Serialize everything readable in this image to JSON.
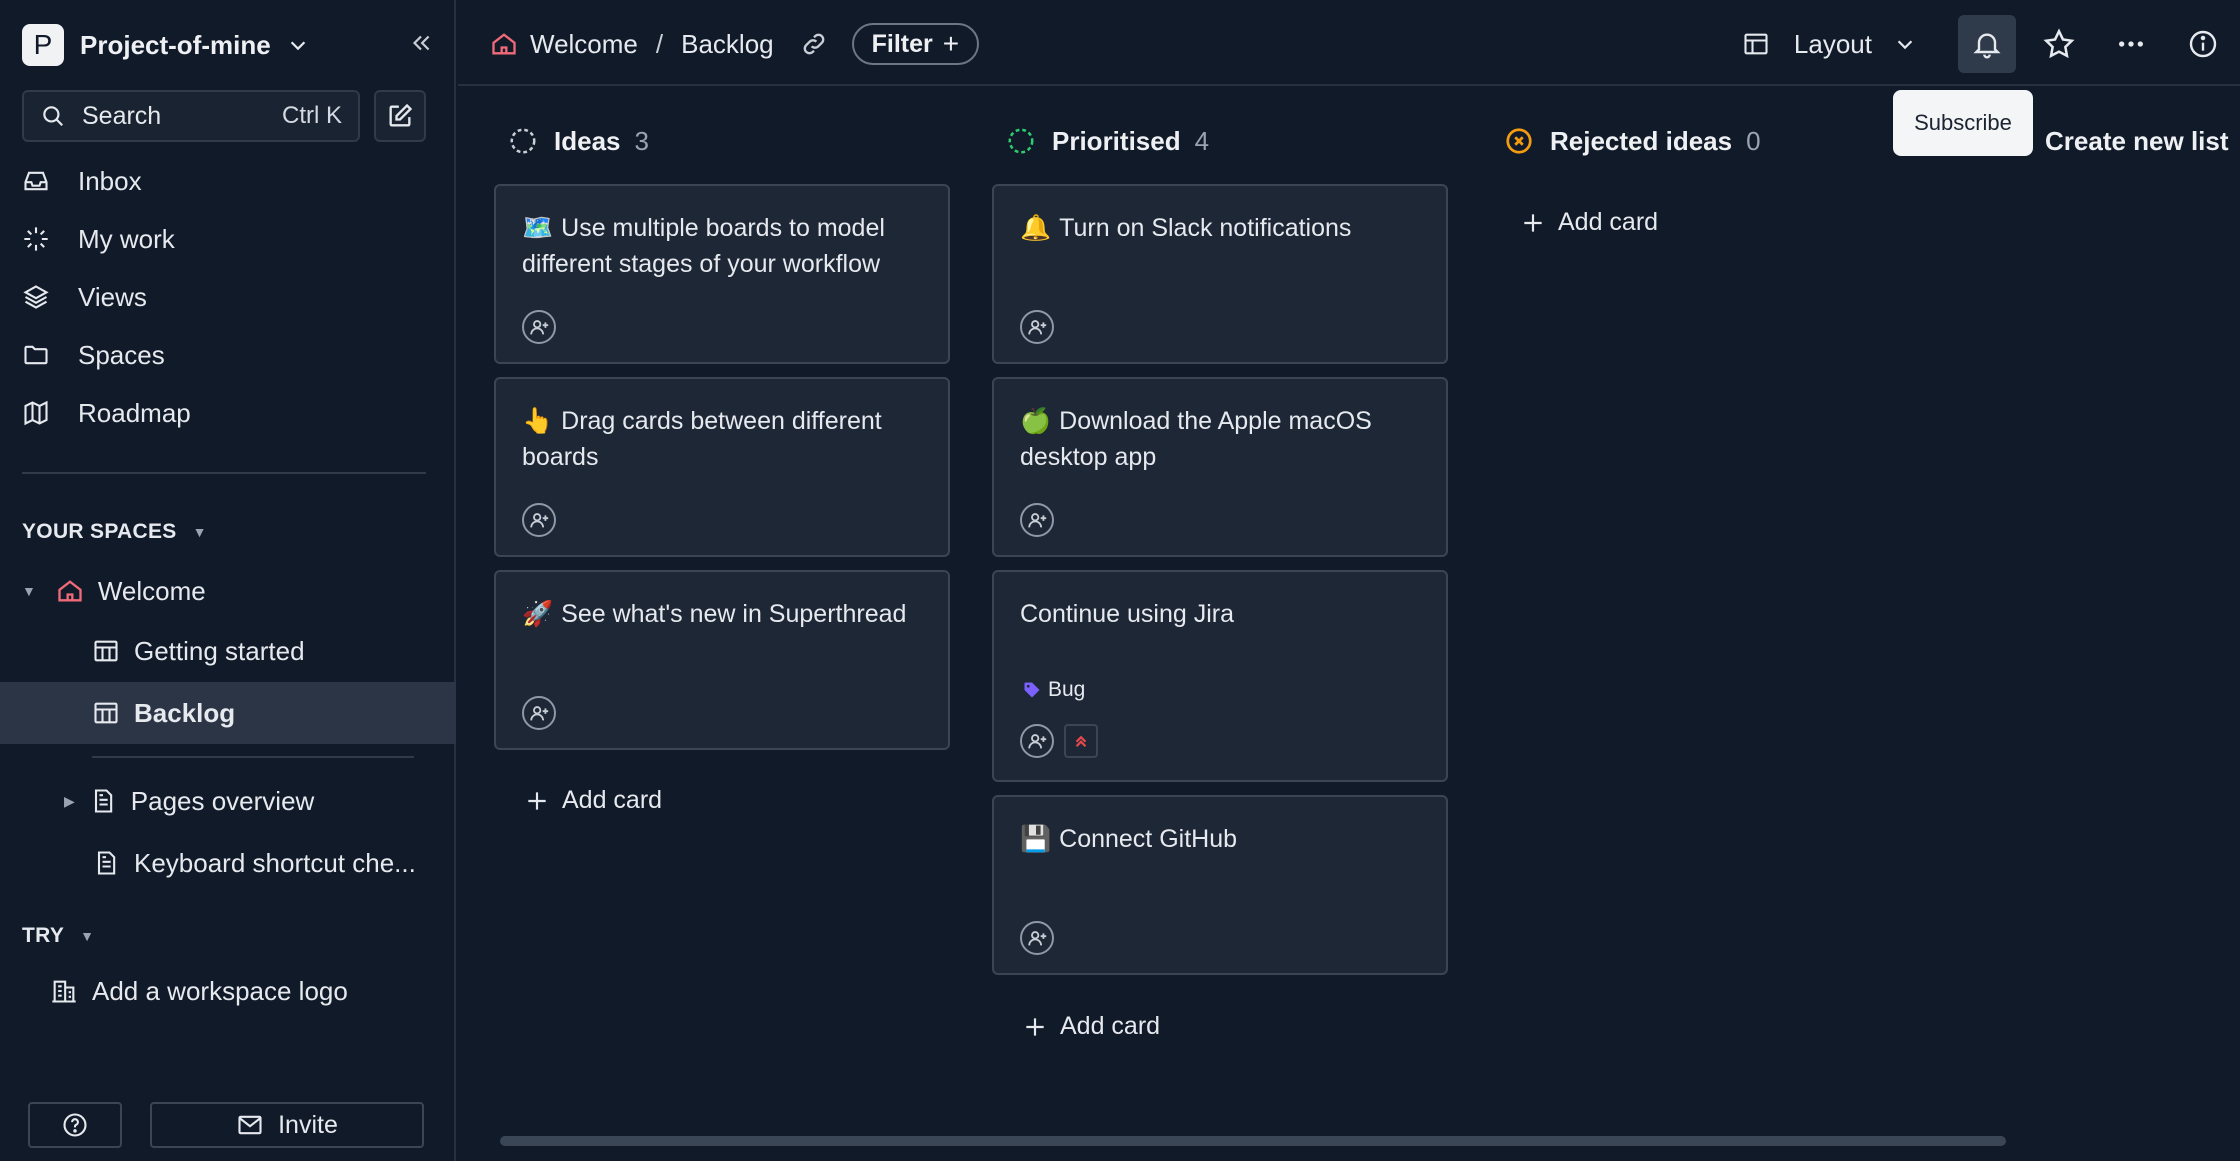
{
  "workspace": {
    "initial": "P",
    "name": "Project-of-mine"
  },
  "search": {
    "label": "Search",
    "shortcut": "Ctrl K"
  },
  "nav": [
    {
      "label": "Inbox",
      "icon": "inbox-icon"
    },
    {
      "label": "My work",
      "icon": "sparkle-icon"
    },
    {
      "label": "Views",
      "icon": "layers-icon"
    },
    {
      "label": "Spaces",
      "icon": "folder-icon"
    },
    {
      "label": "Roadmap",
      "icon": "map-icon"
    }
  ],
  "your_spaces": {
    "label": "YOUR SPACES",
    "space": "Welcome",
    "pages": [
      {
        "label": "Getting started"
      },
      {
        "label": "Backlog"
      },
      {
        "label": "Pages overview"
      },
      {
        "label": "Keyboard shortcut che..."
      }
    ]
  },
  "try": {
    "label": "TRY",
    "item": "Add a workspace logo"
  },
  "footer": {
    "invite": "Invite"
  },
  "breadcrumb": {
    "space": "Welcome",
    "separator": "/",
    "page": "Backlog"
  },
  "toolbar": {
    "filter": "Filter",
    "filter_plus": "+",
    "layout": "Layout"
  },
  "tooltip": "Subscribe",
  "create_list": "Create new list",
  "add_card_label": "Add card",
  "columns": [
    {
      "name": "Ideas",
      "count": "3",
      "cards": [
        {
          "emoji": "🗺️",
          "title": "Use multiple boards to model different stages of your workflow"
        },
        {
          "emoji": "👆",
          "title": "Drag cards between different boards"
        },
        {
          "emoji": "🚀",
          "title": "See what's new in Superthread"
        }
      ]
    },
    {
      "name": "Prioritised",
      "count": "4",
      "cards": [
        {
          "emoji": "🔔",
          "title": "Turn on Slack notifications"
        },
        {
          "emoji": "🍏",
          "title": "Download the Apple macOS desktop app"
        },
        {
          "emoji": "",
          "title": "Continue using Jira",
          "tag": "Bug"
        },
        {
          "emoji": "💾",
          "title": "Connect GitHub"
        }
      ]
    },
    {
      "name": "Rejected ideas",
      "count": "0",
      "cards": []
    }
  ],
  "colors": {
    "background": "#111a28",
    "card": "#1e2736",
    "border": "#3a4556",
    "prioritised": "#2ecc71",
    "rejected": "#f39c12",
    "bug_tag": "#7b61ff",
    "priority_high": "#e5484d"
  }
}
